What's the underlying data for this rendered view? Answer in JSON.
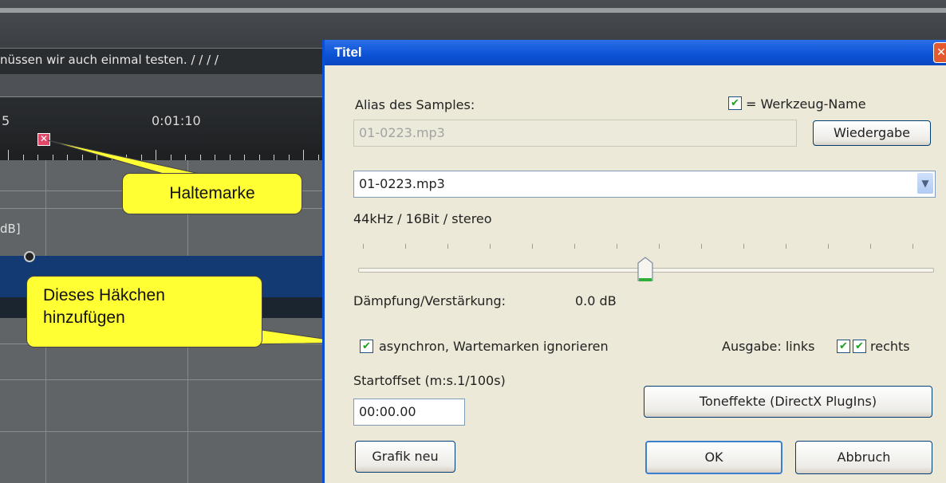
{
  "background": {
    "lyrics_text": "nüssen wir auch einmal testen. / /   /   /",
    "ruler_left_label": "5",
    "ruler_time": "0:01:10",
    "db_label": "dB]"
  },
  "callouts": {
    "halte": "Haltemarke",
    "haekchen_line1": "Dieses Häkchen",
    "haekchen_line2": "hinzufügen"
  },
  "dialog": {
    "title": "Titel",
    "close_glyph": "✕",
    "alias_label": "Alias des Samples:",
    "werkzeug_label": "= Werkzeug-Name",
    "werkzeug_checked": true,
    "alias_value": "01-0223.mp3",
    "wiedergabe_button": "Wiedergabe",
    "sample_select": "01-0223.mp3",
    "format_info": "44kHz / 16Bit / stereo",
    "slider_value_fraction": 0.5,
    "daempfung_label": "Dämpfung/Verstärkung:",
    "daempfung_value": "0.0 dB",
    "async_label": "asynchron, Wartemarken ignorieren",
    "async_checked": true,
    "ausgabe_label": "Ausgabe: links",
    "rechts_label": "rechts",
    "links_checked": true,
    "rechts_checked": true,
    "startoffset_label": "Startoffset (m:s.1/100s)",
    "startoffset_value": "00:00.00",
    "toneffekte_button": "Toneffekte (DirectX PlugIns)",
    "grafik_button": "Grafik neu",
    "ok_button": "OK",
    "abbruch_button": "Abbruch"
  },
  "colors": {
    "callout": "#ffff33",
    "titlebar": "#0b52d5",
    "check_green": "#1f9e1f"
  }
}
